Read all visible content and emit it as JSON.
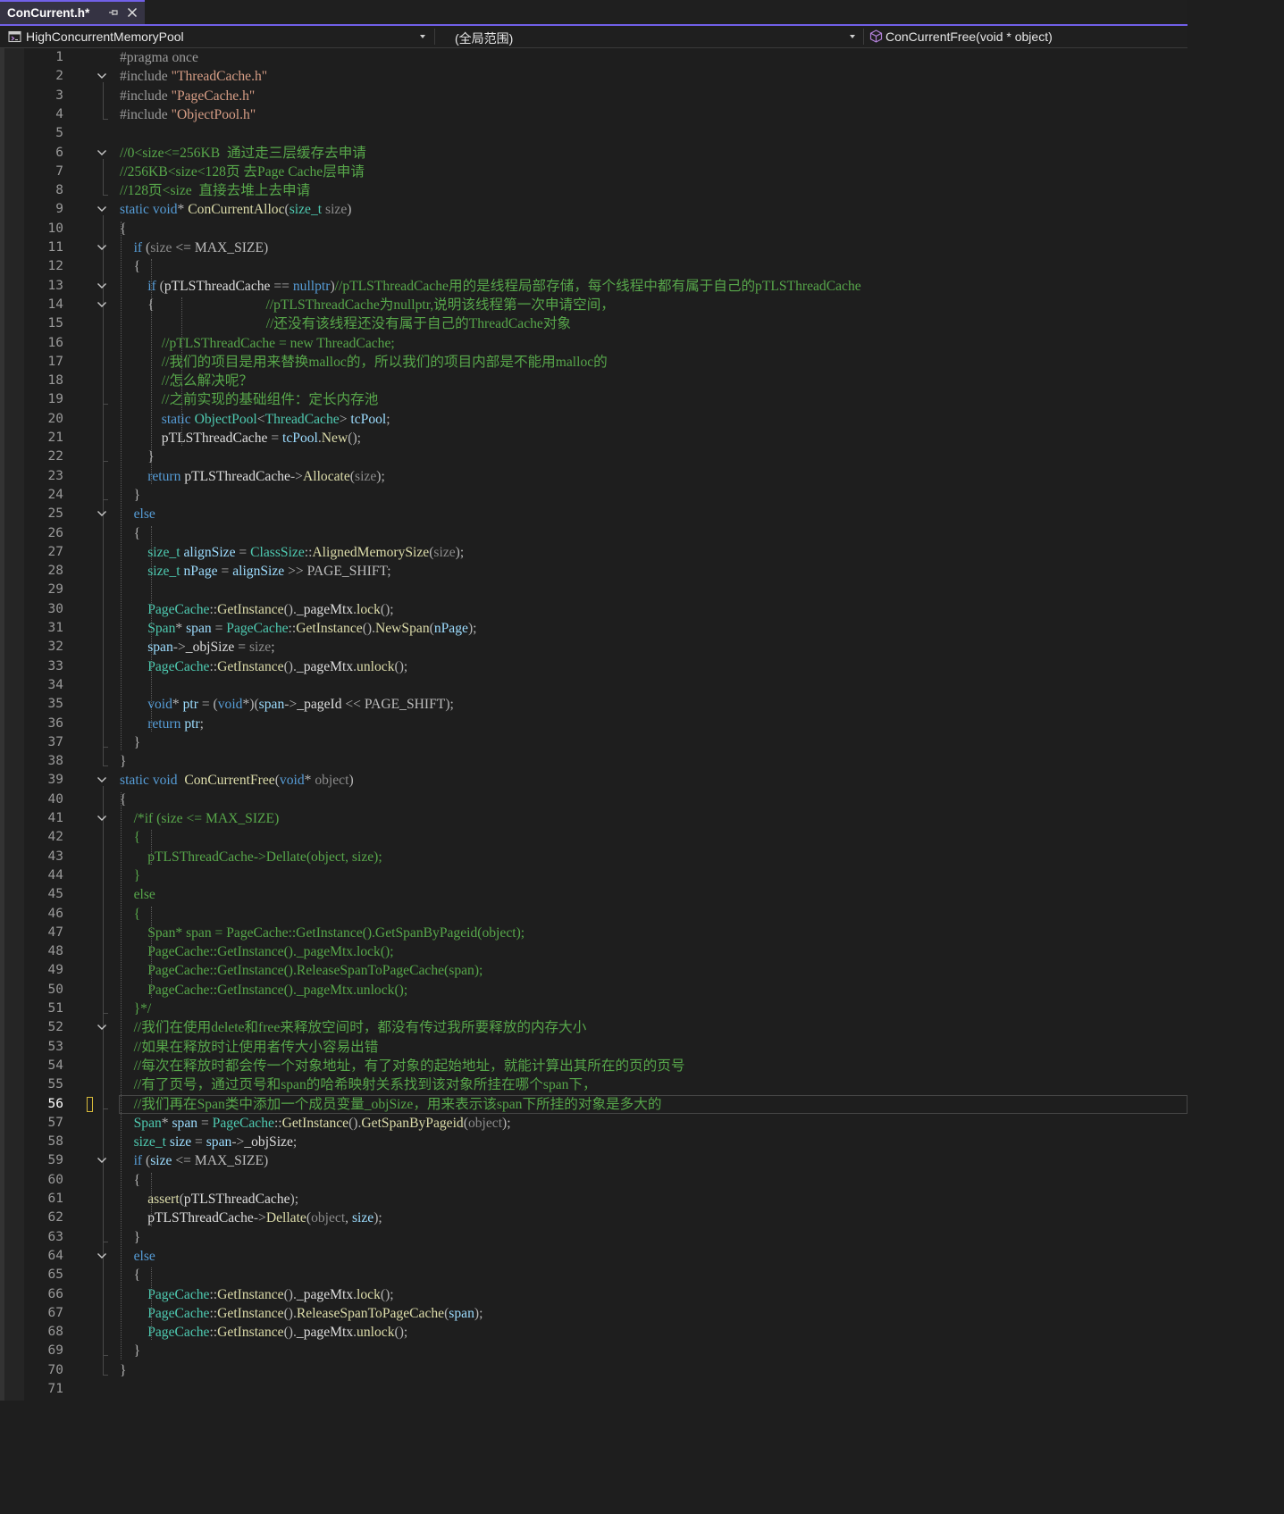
{
  "tab": {
    "title": "ConCurrent.h*"
  },
  "navbar": {
    "project": "HighConcurrentMemoryPool",
    "scope": "(全局范围)",
    "member": "ConCurrentFree(void * object)"
  },
  "editor": {
    "current_line": 56,
    "lines": [
      [
        [
          "pp",
          "#pragma once"
        ]
      ],
      [
        [
          "pp",
          "#include "
        ],
        [
          "str",
          "\"ThreadCache.h\""
        ]
      ],
      [
        [
          "pp",
          "#include "
        ],
        [
          "str",
          "\"PageCache.h\""
        ]
      ],
      [
        [
          "pp",
          "#include "
        ],
        [
          "str",
          "\"ObjectPool.h\""
        ]
      ],
      [],
      [
        [
          "cm",
          "//0<size<=256KB  通过走三层缓存去申请"
        ]
      ],
      [
        [
          "cm",
          "//256KB<size<128页 去Page Cache层申请"
        ]
      ],
      [
        [
          "cm",
          "//128页<size  直接去堆上去申请"
        ]
      ],
      [
        [
          "kw",
          "static "
        ],
        [
          "kw",
          "void"
        ],
        [
          "pun",
          "* "
        ],
        [
          "fn",
          "ConCurrentAlloc"
        ],
        [
          "pun",
          "("
        ],
        [
          "ty",
          "size_t"
        ],
        [
          "dim",
          " size"
        ],
        [
          "pun",
          ")"
        ]
      ],
      [
        [
          "pun",
          "{"
        ]
      ],
      [
        [
          "t",
          "    "
        ],
        [
          "kw",
          "if "
        ],
        [
          "pun",
          "("
        ],
        [
          "dim",
          "size "
        ],
        [
          "pun",
          "<= "
        ],
        [
          "mac",
          "MAX_SIZE"
        ],
        [
          "pun",
          ")"
        ]
      ],
      [
        [
          "t",
          "    "
        ],
        [
          "pun",
          "{"
        ]
      ],
      [
        [
          "t",
          "        "
        ],
        [
          "kw",
          "if "
        ],
        [
          "pun",
          "("
        ],
        [
          "t",
          "pTLSThreadCache "
        ],
        [
          "pun",
          "== "
        ],
        [
          "kw",
          "nullptr"
        ],
        [
          "pun",
          ")"
        ],
        [
          "cm",
          "//pTLSThreadCache用的是线程局部存储，每个线程中都有属于自己的pTLSThreadCache"
        ]
      ],
      [
        [
          "t",
          "        "
        ],
        [
          "pun",
          "{"
        ],
        [
          "t",
          "                                "
        ],
        [
          "cm",
          "//pTLSThreadCache为nullptr,说明该线程第一次申请空间，"
        ]
      ],
      [
        [
          "t",
          "                                          "
        ],
        [
          "cm",
          "//还没有该线程还没有属于自己的ThreadCache对象"
        ]
      ],
      [
        [
          "t",
          "            "
        ],
        [
          "cm",
          "//pTLSThreadCache = new ThreadCache;"
        ]
      ],
      [
        [
          "t",
          "            "
        ],
        [
          "cm",
          "//我们的项目是用来替换malloc的，所以我们的项目内部是不能用malloc的"
        ]
      ],
      [
        [
          "t",
          "            "
        ],
        [
          "cm",
          "//怎么解决呢？"
        ]
      ],
      [
        [
          "t",
          "            "
        ],
        [
          "cm",
          "//之前实现的基础组件：定长内存池"
        ]
      ],
      [
        [
          "t",
          "            "
        ],
        [
          "kw",
          "static "
        ],
        [
          "ty",
          "ObjectPool"
        ],
        [
          "pun",
          "<"
        ],
        [
          "ty",
          "ThreadCache"
        ],
        [
          "pun",
          "> "
        ],
        [
          "var",
          "tcPool"
        ],
        [
          "pun",
          ";"
        ]
      ],
      [
        [
          "t",
          "            pTLSThreadCache "
        ],
        [
          "pun",
          "= "
        ],
        [
          "var",
          "tcPool"
        ],
        [
          "pun",
          "."
        ],
        [
          "fn",
          "New"
        ],
        [
          "pun",
          "();"
        ]
      ],
      [
        [
          "t",
          "        "
        ],
        [
          "pun",
          "}"
        ]
      ],
      [
        [
          "t",
          "        "
        ],
        [
          "kw",
          "return "
        ],
        [
          "t",
          "pTLSThreadCache"
        ],
        [
          "pun",
          "->"
        ],
        [
          "fn",
          "Allocate"
        ],
        [
          "pun",
          "("
        ],
        [
          "dim",
          "size"
        ],
        [
          "pun",
          ");"
        ]
      ],
      [
        [
          "t",
          "    "
        ],
        [
          "pun",
          "}"
        ]
      ],
      [
        [
          "t",
          "    "
        ],
        [
          "kw",
          "else"
        ]
      ],
      [
        [
          "t",
          "    "
        ],
        [
          "pun",
          "{"
        ]
      ],
      [
        [
          "t",
          "        "
        ],
        [
          "ty",
          "size_t "
        ],
        [
          "var",
          "alignSize "
        ],
        [
          "pun",
          "= "
        ],
        [
          "ty",
          "ClassSize"
        ],
        [
          "pun",
          "::"
        ],
        [
          "fn",
          "AlignedMemorySize"
        ],
        [
          "pun",
          "("
        ],
        [
          "dim",
          "size"
        ],
        [
          "pun",
          ");"
        ]
      ],
      [
        [
          "t",
          "        "
        ],
        [
          "ty",
          "size_t "
        ],
        [
          "var",
          "nPage "
        ],
        [
          "pun",
          "= "
        ],
        [
          "var",
          "alignSize "
        ],
        [
          "pun",
          ">> "
        ],
        [
          "mac",
          "PAGE_SHIFT"
        ],
        [
          "pun",
          ";"
        ]
      ],
      [],
      [
        [
          "t",
          "        "
        ],
        [
          "ty",
          "PageCache"
        ],
        [
          "pun",
          "::"
        ],
        [
          "fn",
          "GetInstance"
        ],
        [
          "pun",
          "()."
        ],
        [
          "t",
          "_pageMtx"
        ],
        [
          "pun",
          "."
        ],
        [
          "fn",
          "lock"
        ],
        [
          "pun",
          "();"
        ]
      ],
      [
        [
          "t",
          "        "
        ],
        [
          "ty",
          "Span"
        ],
        [
          "pun",
          "* "
        ],
        [
          "var",
          "span "
        ],
        [
          "pun",
          "= "
        ],
        [
          "ty",
          "PageCache"
        ],
        [
          "pun",
          "::"
        ],
        [
          "fn",
          "GetInstance"
        ],
        [
          "pun",
          "()."
        ],
        [
          "fn",
          "NewSpan"
        ],
        [
          "pun",
          "("
        ],
        [
          "var",
          "nPage"
        ],
        [
          "pun",
          ");"
        ]
      ],
      [
        [
          "t",
          "        "
        ],
        [
          "var",
          "span"
        ],
        [
          "pun",
          "->"
        ],
        [
          "t",
          "_objSize "
        ],
        [
          "pun",
          "= "
        ],
        [
          "dim",
          "size"
        ],
        [
          "pun",
          ";"
        ]
      ],
      [
        [
          "t",
          "        "
        ],
        [
          "ty",
          "PageCache"
        ],
        [
          "pun",
          "::"
        ],
        [
          "fn",
          "GetInstance"
        ],
        [
          "pun",
          "()."
        ],
        [
          "t",
          "_pageMtx"
        ],
        [
          "pun",
          "."
        ],
        [
          "fn",
          "unlock"
        ],
        [
          "pun",
          "();"
        ]
      ],
      [],
      [
        [
          "t",
          "        "
        ],
        [
          "kw",
          "void"
        ],
        [
          "pun",
          "* "
        ],
        [
          "var",
          "ptr "
        ],
        [
          "pun",
          "= ("
        ],
        [
          "kw",
          "void"
        ],
        [
          "pun",
          "*)("
        ],
        [
          "var",
          "span"
        ],
        [
          "pun",
          "->"
        ],
        [
          "t",
          "_pageId "
        ],
        [
          "pun",
          "<< "
        ],
        [
          "mac",
          "PAGE_SHIFT"
        ],
        [
          "pun",
          ");"
        ]
      ],
      [
        [
          "t",
          "        "
        ],
        [
          "kw",
          "return "
        ],
        [
          "var",
          "ptr"
        ],
        [
          "pun",
          ";"
        ]
      ],
      [
        [
          "t",
          "    "
        ],
        [
          "pun",
          "}"
        ]
      ],
      [
        [
          "pun",
          "}"
        ]
      ],
      [
        [
          "kw",
          "static "
        ],
        [
          "kw",
          "void  "
        ],
        [
          "fn",
          "ConCurrentFree"
        ],
        [
          "pun",
          "("
        ],
        [
          "kw",
          "void"
        ],
        [
          "pun",
          "* "
        ],
        [
          "dim",
          "object"
        ],
        [
          "pun",
          ")"
        ]
      ],
      [
        [
          "pun",
          "{"
        ]
      ],
      [
        [
          "t",
          "    "
        ],
        [
          "cm",
          "/*if (size <= MAX_SIZE)"
        ]
      ],
      [
        [
          "t",
          "    "
        ],
        [
          "cm",
          "{"
        ]
      ],
      [
        [
          "t",
          "        "
        ],
        [
          "cm",
          "pTLSThreadCache->Dellate(object, size);"
        ]
      ],
      [
        [
          "t",
          "    "
        ],
        [
          "cm",
          "}"
        ]
      ],
      [
        [
          "t",
          "    "
        ],
        [
          "cm",
          "else"
        ]
      ],
      [
        [
          "t",
          "    "
        ],
        [
          "cm",
          "{"
        ]
      ],
      [
        [
          "t",
          "        "
        ],
        [
          "cm",
          "Span* span = PageCache::GetInstance().GetSpanByPageid(object);"
        ]
      ],
      [
        [
          "t",
          "        "
        ],
        [
          "cm",
          "PageCache::GetInstance()._pageMtx.lock();"
        ]
      ],
      [
        [
          "t",
          "        "
        ],
        [
          "cm",
          "PageCache::GetInstance().ReleaseSpanToPageCache(span);"
        ]
      ],
      [
        [
          "t",
          "        "
        ],
        [
          "cm",
          "PageCache::GetInstance()._pageMtx.unlock();"
        ]
      ],
      [
        [
          "t",
          "    "
        ],
        [
          "cm",
          "}*/"
        ]
      ],
      [
        [
          "t",
          "    "
        ],
        [
          "cm",
          "//我们在使用delete和free来释放空间时，都没有传过我所要释放的内存大小"
        ]
      ],
      [
        [
          "t",
          "    "
        ],
        [
          "cm",
          "//如果在释放时让使用者传大小容易出错"
        ]
      ],
      [
        [
          "t",
          "    "
        ],
        [
          "cm",
          "//每次在释放时都会传一个对象地址，有了对象的起始地址，就能计算出其所在的页的页号"
        ]
      ],
      [
        [
          "t",
          "    "
        ],
        [
          "cm",
          "//有了页号，通过页号和span的哈希映射关系找到该对象所挂在哪个span下，"
        ]
      ],
      [
        [
          "t",
          "    "
        ],
        [
          "cm",
          "//我们再在Span类中添加一个成员变量_objSize，用来表示该span下所挂的对象是多大的"
        ]
      ],
      [
        [
          "t",
          "    "
        ],
        [
          "ty",
          "Span"
        ],
        [
          "pun",
          "* "
        ],
        [
          "var",
          "span "
        ],
        [
          "pun",
          "= "
        ],
        [
          "ty",
          "PageCache"
        ],
        [
          "pun",
          "::"
        ],
        [
          "fn",
          "GetInstance"
        ],
        [
          "pun",
          "()."
        ],
        [
          "fn",
          "GetSpanByPageid"
        ],
        [
          "pun",
          "("
        ],
        [
          "dim",
          "object"
        ],
        [
          "pun",
          ");"
        ]
      ],
      [
        [
          "t",
          "    "
        ],
        [
          "ty",
          "size_t "
        ],
        [
          "var",
          "size "
        ],
        [
          "pun",
          "= "
        ],
        [
          "var",
          "span"
        ],
        [
          "pun",
          "->"
        ],
        [
          "t",
          "_objSize"
        ],
        [
          "pun",
          ";"
        ]
      ],
      [
        [
          "t",
          "    "
        ],
        [
          "kw",
          "if "
        ],
        [
          "pun",
          "("
        ],
        [
          "var",
          "size "
        ],
        [
          "pun",
          "<= "
        ],
        [
          "mac",
          "MAX_SIZE"
        ],
        [
          "pun",
          ")"
        ]
      ],
      [
        [
          "t",
          "    "
        ],
        [
          "pun",
          "{"
        ]
      ],
      [
        [
          "t",
          "        "
        ],
        [
          "fn",
          "assert"
        ],
        [
          "pun",
          "("
        ],
        [
          "t",
          "pTLSThreadCache"
        ],
        [
          "pun",
          ");"
        ]
      ],
      [
        [
          "t",
          "        pTLSThreadCache"
        ],
        [
          "pun",
          "->"
        ],
        [
          "fn",
          "Dellate"
        ],
        [
          "pun",
          "("
        ],
        [
          "dim",
          "object"
        ],
        [
          "pun",
          ", "
        ],
        [
          "var",
          "size"
        ],
        [
          "pun",
          ");"
        ]
      ],
      [
        [
          "t",
          "    "
        ],
        [
          "pun",
          "}"
        ]
      ],
      [
        [
          "t",
          "    "
        ],
        [
          "kw",
          "else"
        ]
      ],
      [
        [
          "t",
          "    "
        ],
        [
          "pun",
          "{"
        ]
      ],
      [
        [
          "t",
          "        "
        ],
        [
          "ty",
          "PageCache"
        ],
        [
          "pun",
          "::"
        ],
        [
          "fn",
          "GetInstance"
        ],
        [
          "pun",
          "()."
        ],
        [
          "t",
          "_pageMtx"
        ],
        [
          "pun",
          "."
        ],
        [
          "fn",
          "lock"
        ],
        [
          "pun",
          "();"
        ]
      ],
      [
        [
          "t",
          "        "
        ],
        [
          "ty",
          "PageCache"
        ],
        [
          "pun",
          "::"
        ],
        [
          "fn",
          "GetInstance"
        ],
        [
          "pun",
          "()."
        ],
        [
          "fn",
          "ReleaseSpanToPageCache"
        ],
        [
          "pun",
          "("
        ],
        [
          "var",
          "span"
        ],
        [
          "pun",
          ");"
        ]
      ],
      [
        [
          "t",
          "        "
        ],
        [
          "ty",
          "PageCache"
        ],
        [
          "pun",
          "::"
        ],
        [
          "fn",
          "GetInstance"
        ],
        [
          "pun",
          "()."
        ],
        [
          "t",
          "_pageMtx"
        ],
        [
          "pun",
          "."
        ],
        [
          "fn",
          "unlock"
        ],
        [
          "pun",
          "();"
        ]
      ],
      [
        [
          "t",
          "    "
        ],
        [
          "pun",
          "}"
        ]
      ],
      [
        [
          "pun",
          "}"
        ]
      ],
      []
    ],
    "fold_lines": [
      2,
      6,
      9,
      11,
      13,
      14,
      25,
      39,
      41,
      52,
      59,
      64
    ]
  }
}
